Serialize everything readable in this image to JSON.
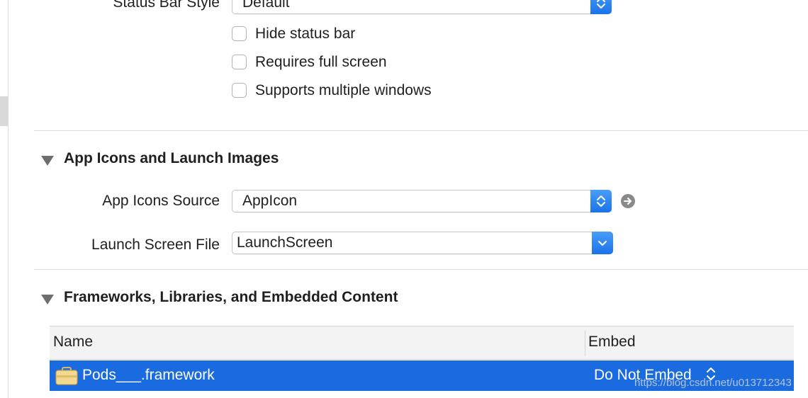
{
  "general": {
    "status_bar_style": {
      "label": "Status Bar Style",
      "value": "Default"
    },
    "checkboxes": [
      {
        "label": "Hide status bar",
        "checked": false
      },
      {
        "label": "Requires full screen",
        "checked": false
      },
      {
        "label": "Supports multiple windows",
        "checked": false
      }
    ]
  },
  "app_icons": {
    "title": "App Icons and Launch Images",
    "icons_source": {
      "label": "App Icons Source",
      "value": "AppIcon"
    },
    "launch_screen": {
      "label": "Launch Screen File",
      "value": "LaunchScreen"
    }
  },
  "frameworks": {
    "title": "Frameworks, Libraries, and Embedded Content",
    "columns": [
      "Name",
      "Embed"
    ],
    "rows": [
      {
        "name": "Pods___.framework",
        "embed": "Do Not Embed",
        "selected": true
      }
    ]
  },
  "watermark": "https://blog.csdn.net/u013712343",
  "colors": {
    "accent": "#1a73e8",
    "selection": "#1a6be0"
  }
}
